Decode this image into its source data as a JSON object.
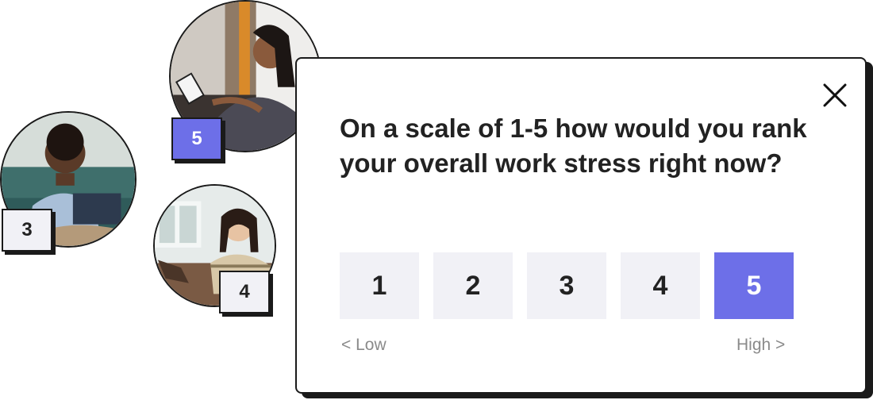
{
  "avatars": [
    {
      "badge_value": "3",
      "selected": false
    },
    {
      "badge_value": "5",
      "selected": true
    },
    {
      "badge_value": "4",
      "selected": false
    }
  ],
  "survey": {
    "question": "On a scale of 1-5 how would you rank your overall work stress right now?",
    "options": [
      "1",
      "2",
      "3",
      "4",
      "5"
    ],
    "selected_option": "5",
    "low_label": "< Low",
    "high_label": "High >",
    "close_icon": "close-icon"
  },
  "colors": {
    "accent": "#6d6fe8",
    "option_background": "#f1f1f6",
    "border": "#1a1a1a",
    "muted_text": "#8a8a8a"
  }
}
